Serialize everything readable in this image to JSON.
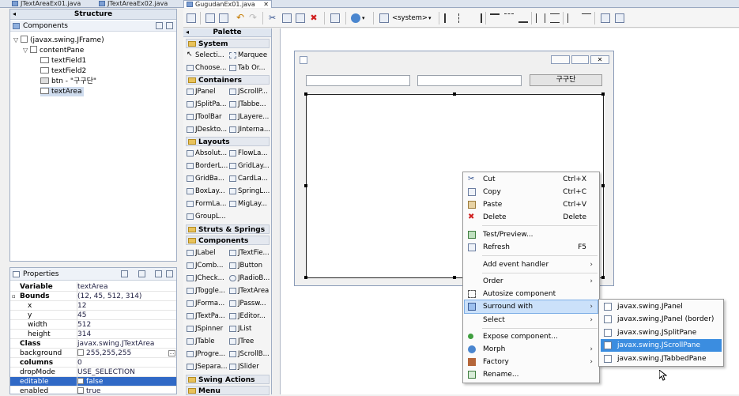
{
  "tabs": [
    {
      "label": "JTextAreaEx01.java"
    },
    {
      "label": "JTextAreaEx02.java"
    },
    {
      "label": "GugudanEx01.java"
    }
  ],
  "structure": {
    "title": "Structure",
    "components_label": "Components",
    "tree": [
      {
        "label": "(javax.swing.JFrame)"
      },
      {
        "label": "contentPane"
      },
      {
        "label": "textField1"
      },
      {
        "label": "textField2"
      },
      {
        "label": "btn - \"구구단\""
      },
      {
        "label": "textArea"
      }
    ]
  },
  "properties": {
    "title": "Properties",
    "rows": [
      {
        "key": "Variable",
        "value": "textArea"
      },
      {
        "key": "Bounds",
        "value": "(12, 45, 512, 314)"
      },
      {
        "key": "x",
        "value": "12"
      },
      {
        "key": "y",
        "value": "45"
      },
      {
        "key": "width",
        "value": "512"
      },
      {
        "key": "height",
        "value": "314"
      },
      {
        "key": "Class",
        "value": "javax.swing.JTextArea"
      },
      {
        "key": "background",
        "value": "255,255,255"
      },
      {
        "key": "columns",
        "value": "0"
      },
      {
        "key": "dropMode",
        "value": "USE_SELECTION"
      },
      {
        "key": "editable",
        "value": "false"
      },
      {
        "key": "enabled",
        "value": "true"
      }
    ]
  },
  "palette": {
    "title": "Palette",
    "categories": {
      "system": "System",
      "containers": "Containers",
      "layouts": "Layouts",
      "struts": "Struts & Springs",
      "components": "Components",
      "swing_actions": "Swing Actions",
      "menu": "Menu"
    },
    "items": {
      "system": [
        "Selecti...",
        "Marquee",
        "Choose...",
        "Tab Or..."
      ],
      "containers": [
        "JPanel",
        "JScrollP...",
        "JSplitPa...",
        "JTabbe...",
        "JToolBar",
        "JLayere...",
        "JDeskto...",
        "JInterna..."
      ],
      "layouts": [
        "Absolut...",
        "FlowLa...",
        "BorderL...",
        "GridLay...",
        "GridBa...",
        "CardLa...",
        "BoxLay...",
        "SpringL...",
        "FormLa...",
        "MigLay...",
        "GroupL..."
      ],
      "components": [
        "JLabel",
        "JTextFie...",
        "JComb...",
        "JButton",
        "JCheck...",
        "JRadioB...",
        "JToggle...",
        "JTextArea",
        "JForma...",
        "JPassw...",
        "JTextPa...",
        "JEditor...",
        "JSpinner",
        "JList",
        "JTable",
        "JTree",
        "JProgre...",
        "JScrollB...",
        "JSepara...",
        "JSlider"
      ]
    }
  },
  "toolbar": {
    "system_combo": "<system>"
  },
  "design": {
    "button_label": "구구단"
  },
  "context_menu": {
    "items": [
      {
        "label": "Cut",
        "shortcut": "Ctrl+X"
      },
      {
        "label": "Copy",
        "shortcut": "Ctrl+C"
      },
      {
        "label": "Paste",
        "shortcut": "Ctrl+V"
      },
      {
        "label": "Delete",
        "shortcut": "Delete"
      },
      {
        "label": "Test/Preview...",
        "shortcut": ""
      },
      {
        "label": "Refresh",
        "shortcut": "F5"
      },
      {
        "label": "Add event handler",
        "shortcut": ""
      },
      {
        "label": "Order",
        "shortcut": ""
      },
      {
        "label": "Autosize component",
        "shortcut": ""
      },
      {
        "label": "Surround with",
        "shortcut": ""
      },
      {
        "label": "Select",
        "shortcut": ""
      },
      {
        "label": "Expose component...",
        "shortcut": ""
      },
      {
        "label": "Morph",
        "shortcut": ""
      },
      {
        "label": "Factory",
        "shortcut": ""
      },
      {
        "label": "Rename...",
        "shortcut": ""
      }
    ],
    "submenu": [
      {
        "label": "javax.swing.JPanel"
      },
      {
        "label": "javax.swing.JPanel (border)"
      },
      {
        "label": "javax.swing.JSplitPane"
      },
      {
        "label": "javax.swing.JScrollPane"
      },
      {
        "label": "javax.swing.JTabbedPane"
      }
    ]
  },
  "colors": {
    "selection": "#3069c6",
    "menu_highlight": "#3b8de0"
  }
}
